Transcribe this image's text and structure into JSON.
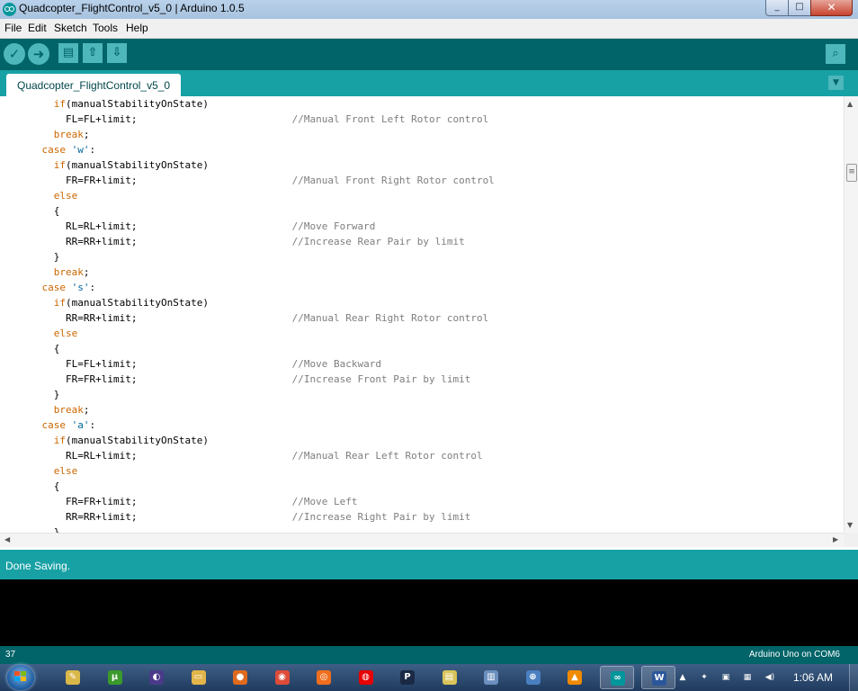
{
  "window": {
    "title": "Quadcopter_FlightControl_v5_0 | Arduino 1.0.5",
    "controls": {
      "minimize": "_",
      "maximize": "□",
      "close": "✕"
    }
  },
  "menu": [
    "File",
    "Edit",
    "Sketch",
    "Tools",
    "Help"
  ],
  "toolbar": {
    "verify_icon": "✓",
    "upload_icon": "➜",
    "new_icon": "▤",
    "open_icon": "⇧",
    "save_icon": "⇩",
    "serial_monitor_icon": "⌕"
  },
  "tabs": [
    {
      "label": "Quadcopter_FlightControl_v5_0",
      "active": true
    }
  ],
  "tab_menu_icon": "▼",
  "editor": {
    "colors": {
      "keyword": "#cc6600",
      "string": "#006699",
      "comment": "#7e7e7e"
    },
    "lines": [
      [
        {
          "t": "      "
        },
        {
          "t": "if",
          "c": "kw"
        },
        {
          "t": "(manualStabilityOnState)"
        }
      ],
      [
        {
          "t": "        FL=FL+limit;                          "
        },
        {
          "t": "//Manual Front Left Rotor control",
          "c": "cm"
        }
      ],
      [
        {
          "t": "      "
        },
        {
          "t": "break",
          "c": "kw"
        },
        {
          "t": ";"
        }
      ],
      [
        {
          "t": "    "
        },
        {
          "t": "case",
          "c": "kw"
        },
        {
          "t": " "
        },
        {
          "t": "'w'",
          "c": "str"
        },
        {
          "t": ":"
        }
      ],
      [
        {
          "t": "      "
        },
        {
          "t": "if",
          "c": "kw"
        },
        {
          "t": "(manualStabilityOnState)"
        }
      ],
      [
        {
          "t": "        FR=FR+limit;                          "
        },
        {
          "t": "//Manual Front Right Rotor control",
          "c": "cm"
        }
      ],
      [
        {
          "t": "      "
        },
        {
          "t": "else",
          "c": "kw"
        }
      ],
      [
        {
          "t": "      {"
        }
      ],
      [
        {
          "t": "        RL=RL+limit;                          "
        },
        {
          "t": "//Move Forward",
          "c": "cm"
        }
      ],
      [
        {
          "t": "        RR=RR+limit;                          "
        },
        {
          "t": "//Increase Rear Pair by limit",
          "c": "cm"
        }
      ],
      [
        {
          "t": "      }"
        }
      ],
      [
        {
          "t": "      "
        },
        {
          "t": "break",
          "c": "kw"
        },
        {
          "t": ";"
        }
      ],
      [
        {
          "t": "    "
        },
        {
          "t": "case",
          "c": "kw"
        },
        {
          "t": " "
        },
        {
          "t": "'s'",
          "c": "str"
        },
        {
          "t": ":"
        }
      ],
      [
        {
          "t": "      "
        },
        {
          "t": "if",
          "c": "kw"
        },
        {
          "t": "(manualStabilityOnState)"
        }
      ],
      [
        {
          "t": "        RR=RR+limit;                          "
        },
        {
          "t": "//Manual Rear Right Rotor control",
          "c": "cm"
        }
      ],
      [
        {
          "t": "      "
        },
        {
          "t": "else",
          "c": "kw"
        }
      ],
      [
        {
          "t": "      {"
        }
      ],
      [
        {
          "t": "        FL=FL+limit;                          "
        },
        {
          "t": "//Move Backward",
          "c": "cm"
        }
      ],
      [
        {
          "t": "        FR=FR+limit;                          "
        },
        {
          "t": "//Increase Front Pair by limit",
          "c": "cm"
        }
      ],
      [
        {
          "t": "      }"
        }
      ],
      [
        {
          "t": "      "
        },
        {
          "t": "break",
          "c": "kw"
        },
        {
          "t": ";"
        }
      ],
      [
        {
          "t": "    "
        },
        {
          "t": "case",
          "c": "kw"
        },
        {
          "t": " "
        },
        {
          "t": "'a'",
          "c": "str"
        },
        {
          "t": ":"
        }
      ],
      [
        {
          "t": "      "
        },
        {
          "t": "if",
          "c": "kw"
        },
        {
          "t": "(manualStabilityOnState)"
        }
      ],
      [
        {
          "t": "        RL=RL+limit;                          "
        },
        {
          "t": "//Manual Rear Left Rotor control",
          "c": "cm"
        }
      ],
      [
        {
          "t": "      "
        },
        {
          "t": "else",
          "c": "kw"
        }
      ],
      [
        {
          "t": "      {"
        }
      ],
      [
        {
          "t": "        FR=FR+limit;                          "
        },
        {
          "t": "//Move Left",
          "c": "cm"
        }
      ],
      [
        {
          "t": "        RR=RR+limit;                          "
        },
        {
          "t": "//Increase Right Pair by limit",
          "c": "cm"
        }
      ],
      [
        {
          "t": "      }"
        }
      ]
    ]
  },
  "scrollbars": {
    "up": "▲",
    "down": "▼",
    "left": "◀",
    "right": "▶",
    "thumb_grip": "≡"
  },
  "status": {
    "message": "Done Saving."
  },
  "footer": {
    "line_number": "37",
    "board_port": "Arduino Uno on COM6"
  },
  "taskbar": {
    "items": [
      {
        "name": "notepad",
        "glyph": "✎",
        "color": "#d9b84a"
      },
      {
        "name": "utorrent",
        "glyph": "µ",
        "color": "#3a9a2c"
      },
      {
        "name": "eclipse",
        "glyph": "◐",
        "color": "#4b3a8a"
      },
      {
        "name": "explorer",
        "glyph": "▭",
        "color": "#e2b54a"
      },
      {
        "name": "firefox",
        "glyph": "●",
        "color": "#e06a1d"
      },
      {
        "name": "chrome",
        "glyph": "◉",
        "color": "#dd4b39"
      },
      {
        "name": "origin",
        "glyph": "◎",
        "color": "#f06e1e"
      },
      {
        "name": "vodafone",
        "glyph": "◍",
        "color": "#e60000"
      },
      {
        "name": "pandora",
        "glyph": "P",
        "color": "#1a2a44"
      },
      {
        "name": "sticky-notes",
        "glyph": "▤",
        "color": "#d8c45a"
      },
      {
        "name": "documents",
        "glyph": "▥",
        "color": "#6b8fbf"
      },
      {
        "name": "network",
        "glyph": "⊕",
        "color": "#4a7fc0"
      },
      {
        "name": "vlc",
        "glyph": "▲",
        "color": "#f08a00"
      },
      {
        "name": "arduino",
        "glyph": "∞",
        "color": "#00979c"
      },
      {
        "name": "word",
        "glyph": "W",
        "color": "#2b579a"
      }
    ],
    "tray_icons": [
      "▲",
      "✦",
      "▣",
      "▦",
      "◀)"
    ],
    "clock": "1:06 AM"
  }
}
